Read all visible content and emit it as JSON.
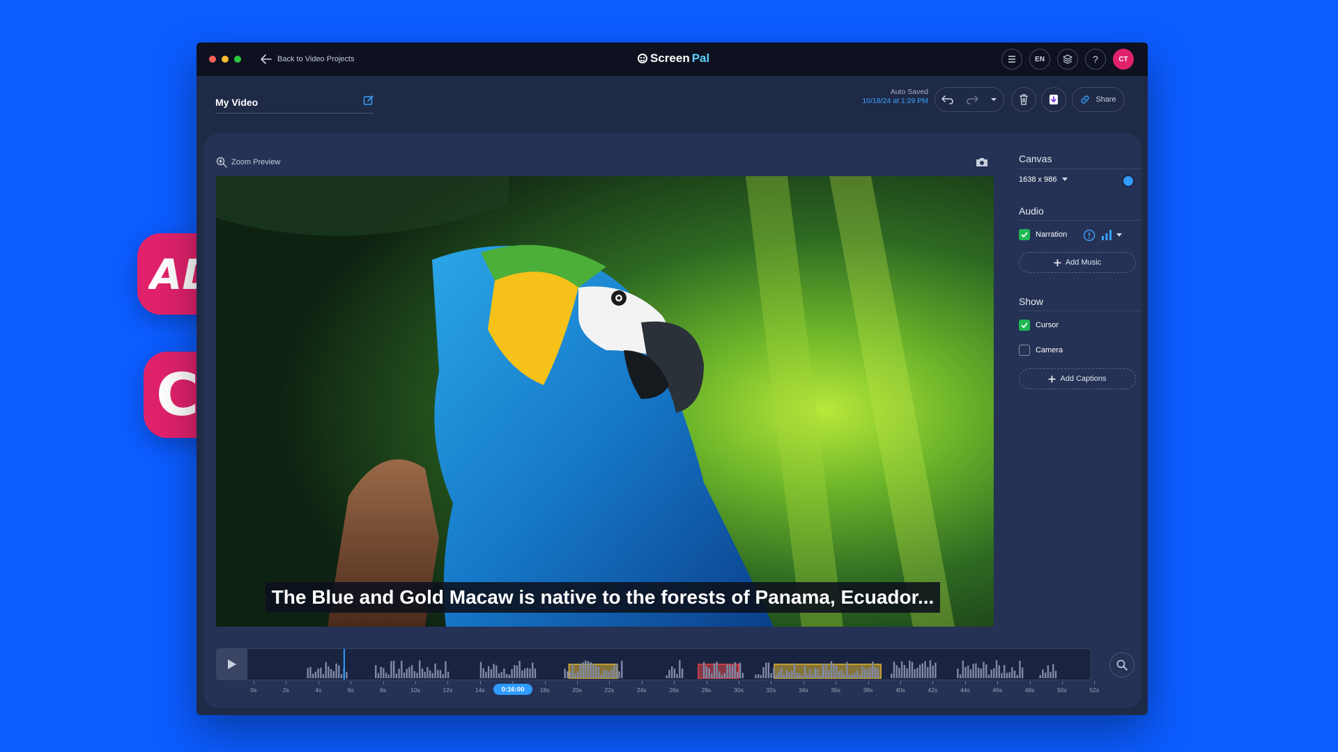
{
  "colors": {
    "background": "#0c5cff",
    "accent": "#2f9bff",
    "pink": "#e0226b",
    "ad_segment": "#e0b431",
    "audio_segment": "#e24646",
    "checkbox_on": "#1db954"
  },
  "badges": {
    "audio_description": "AD)))",
    "closed_captions": "CC"
  },
  "titlebar": {
    "back_label": "Back to Video Projects",
    "logo_screen": "Screen",
    "logo_pal": "Pal",
    "lang": "EN",
    "help": "?",
    "avatar": "CT"
  },
  "project": {
    "title": "My Video",
    "autosave_label": "Auto Saved",
    "autosave_date": "10/18/24 at 1:29 PM",
    "share_label": "Share"
  },
  "preview": {
    "zoom_label": "Zoom Preview",
    "caption": "The Blue and Gold Macaw is native to the forests of Panama, Ecuador..."
  },
  "sidebar": {
    "canvas": {
      "title": "Canvas",
      "size": "1638 x 986"
    },
    "audio": {
      "title": "Audio",
      "narration": "Narration",
      "narration_checked": true,
      "add_music": "Add Music"
    },
    "show": {
      "title": "Show",
      "cursor": "Cursor",
      "cursor_checked": true,
      "camera": "Camera",
      "camera_checked": false,
      "add_captions": "Add Captions"
    }
  },
  "timeline": {
    "current_time": "0:16:00",
    "labels": [
      "0s",
      "2s",
      "4s",
      "6s",
      "8s",
      "10s",
      "12s",
      "14s",
      "16s",
      "18s",
      "20s",
      "22s",
      "24s",
      "26s",
      "28s",
      "30s",
      "32s",
      "34s",
      "36s",
      "38s",
      "40s",
      "42s",
      "44s",
      "46s",
      "48s",
      "50s",
      "52s"
    ],
    "ad_segments": [
      [
        19.5,
        22.5
      ],
      [
        32.2,
        38.8
      ]
    ],
    "audio_segments": [
      [
        27.5,
        30
      ]
    ]
  }
}
